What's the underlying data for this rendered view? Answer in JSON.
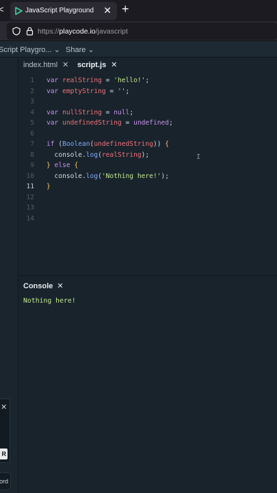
{
  "browser": {
    "tab_title": "JavaScript Playground",
    "tab_close": "✕",
    "back": "<",
    "new_tab": "+",
    "url_prefix": "https://",
    "url_domain": "playcode.io",
    "url_path": "/javascript"
  },
  "app": {
    "project_label": "Script Playgro...",
    "share_label": "Share",
    "chevron": "⌄"
  },
  "editor": {
    "tabs": [
      {
        "label": "index.html",
        "close": "✕"
      },
      {
        "label": "script.js",
        "close": "✕"
      }
    ],
    "active_line": 11,
    "cursor_glyph": "I"
  },
  "code_lines": [
    {
      "n": "1",
      "tokens": [
        [
          "kw",
          "var "
        ],
        [
          "vr",
          "realString"
        ],
        [
          "pl",
          " = "
        ],
        [
          "str",
          "'hello!'"
        ],
        [
          "pl",
          ";"
        ]
      ]
    },
    {
      "n": "2",
      "tokens": [
        [
          "kw",
          "var "
        ],
        [
          "vr",
          "emptyString"
        ],
        [
          "pl",
          " = "
        ],
        [
          "str",
          "''"
        ],
        [
          "pl",
          ";"
        ]
      ]
    },
    {
      "n": "3",
      "tokens": []
    },
    {
      "n": "4",
      "tokens": [
        [
          "kw",
          "var "
        ],
        [
          "vr",
          "nullString"
        ],
        [
          "pl",
          " = "
        ],
        [
          "kw",
          "null"
        ],
        [
          "pl",
          ";"
        ]
      ]
    },
    {
      "n": "5",
      "tokens": [
        [
          "kw",
          "var "
        ],
        [
          "vr",
          "undefinedString"
        ],
        [
          "pl",
          " = "
        ],
        [
          "kw",
          "undefined"
        ],
        [
          "pl",
          ";"
        ]
      ]
    },
    {
      "n": "6",
      "tokens": []
    },
    {
      "n": "7",
      "tokens": [
        [
          "kw",
          "if "
        ],
        [
          "pl",
          "("
        ],
        [
          "fn",
          "Boolean"
        ],
        [
          "pl",
          "("
        ],
        [
          "vr",
          "undefinedString"
        ],
        [
          "pl",
          ")) "
        ],
        [
          "br",
          "{"
        ]
      ]
    },
    {
      "n": "8",
      "tokens": [
        [
          "pl",
          "  console."
        ],
        [
          "fn",
          "log"
        ],
        [
          "pl",
          "("
        ],
        [
          "vr",
          "realString"
        ],
        [
          "pl",
          ");"
        ]
      ]
    },
    {
      "n": "9",
      "tokens": [
        [
          "br",
          "}"
        ],
        [
          "kw",
          " else "
        ],
        [
          "br",
          "{"
        ]
      ]
    },
    {
      "n": "10",
      "tokens": [
        [
          "pl",
          "  console."
        ],
        [
          "fn",
          "log"
        ],
        [
          "pl",
          "("
        ],
        [
          "str",
          "'Nothing here!'"
        ],
        [
          "pl",
          ");"
        ]
      ]
    },
    {
      "n": "11",
      "tokens": [
        [
          "br",
          "}"
        ]
      ]
    },
    {
      "n": "12",
      "tokens": []
    },
    {
      "n": "13",
      "tokens": []
    },
    {
      "n": "14",
      "tokens": []
    }
  ],
  "console": {
    "title": "Console",
    "close": "✕",
    "output": "Nothing here!"
  },
  "overlay": {
    "close": "✕",
    "key_label": "R",
    "fragment_text": "ord"
  },
  "colors": {
    "keyword": "#c792ea",
    "variable": "#f07178",
    "string": "#c3e88d",
    "function": "#82aaff",
    "editor_bg": "#18232c"
  }
}
